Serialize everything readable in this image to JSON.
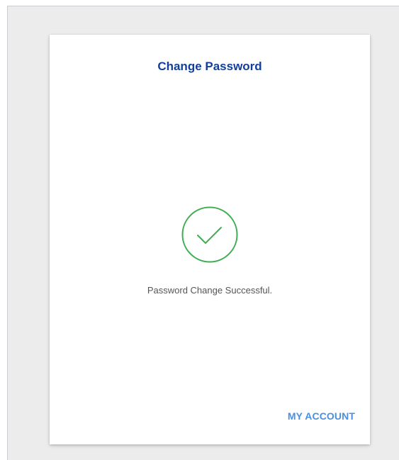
{
  "card": {
    "title": "Change Password",
    "message": "Password Change Successful.",
    "account_link_label": "MY ACCOUNT"
  },
  "icons": {
    "success": "checkmark-circle-icon"
  },
  "colors": {
    "title": "#123e9c",
    "success_green": "#3fae52",
    "link": "#4a8fe0",
    "message_text": "#555555",
    "background": "#ececec",
    "card_background": "#ffffff"
  }
}
